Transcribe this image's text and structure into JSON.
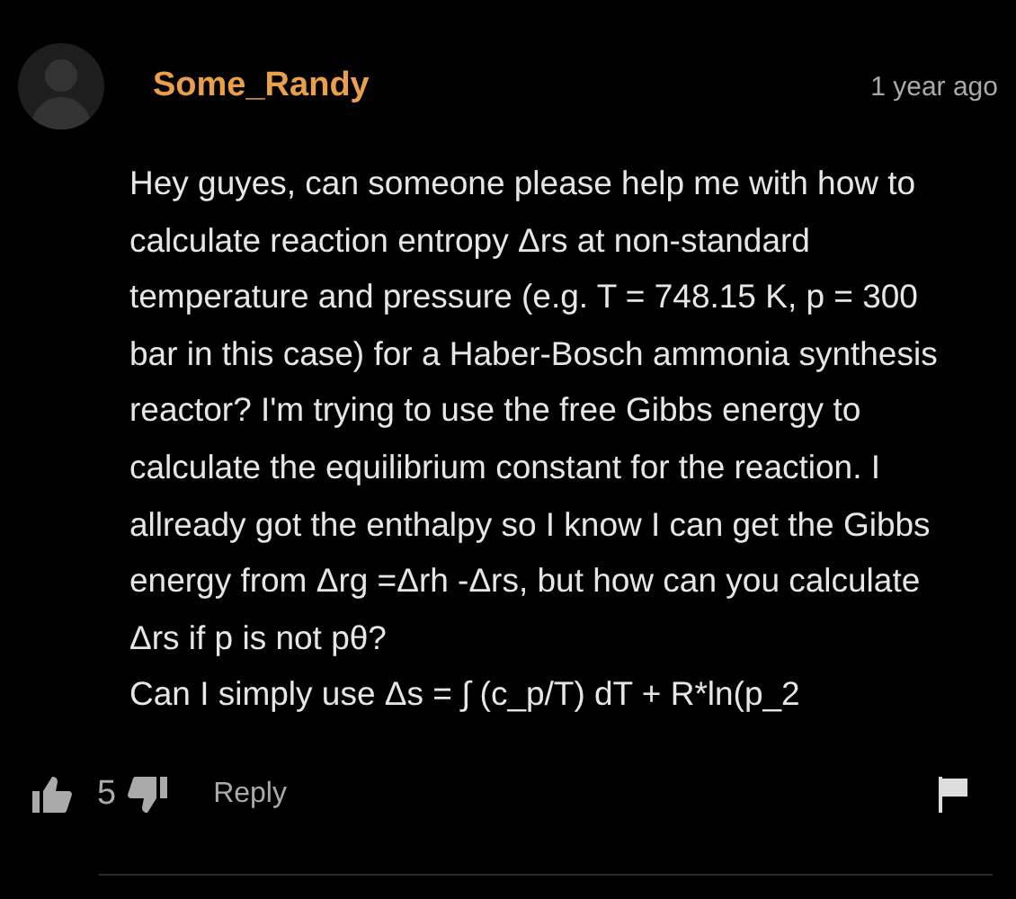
{
  "comment": {
    "author": "Some_Randy",
    "time": "1 year ago",
    "paragraphs": [
      "Hey guyes, can someone please help me with how to calculate reaction entropy Δrs at non-standard temperature and pressure (e.g. T = 748.15 K, p = 300 bar in this case) for a Haber-Bosch ammonia synthesis reactor? I'm trying to use the free Gibbs energy to calculate the equilibrium constant for the reaction. I allready got the enthalpy so I know I can get the Gibbs energy from Δrg =Δrh -Δrs, but how can you calculate Δrs if p is not pθ?",
      "Can I simply use Δs = ∫ (c_p/T) dT + R*ln(p_2"
    ],
    "likes": "5",
    "reply": "Reply"
  }
}
